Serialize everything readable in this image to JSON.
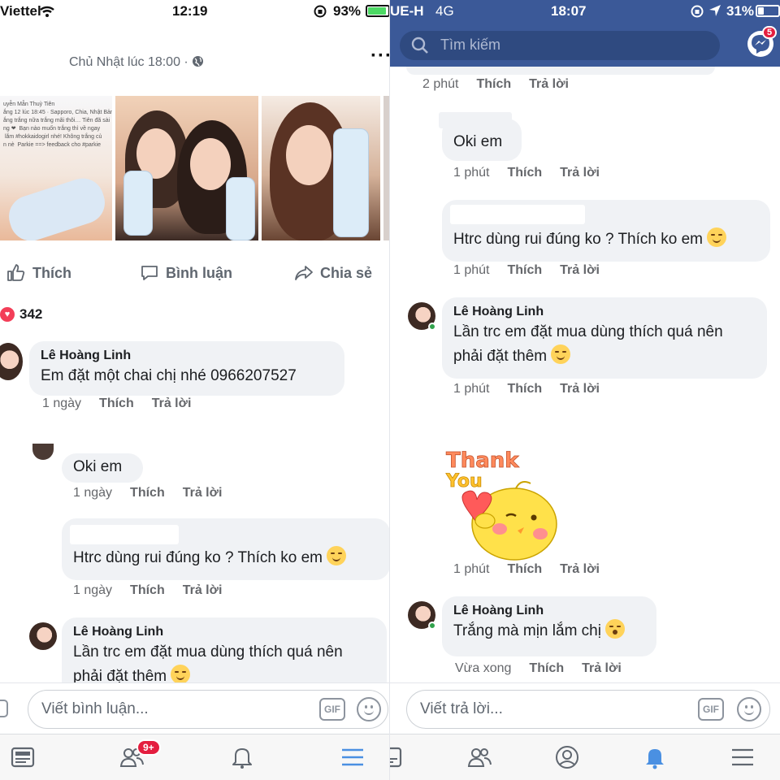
{
  "left": {
    "status": {
      "carrier": "Viettel",
      "time": "12:19",
      "battery": "93%",
      "battery_level": 0.93
    },
    "post": {
      "time": "Chủ Nhật lúc 18:00 ·",
      "photo_text": "uyễn Mẫn Thuỳ Tiên\nắng 12 lúc 18:45 · Sapporo, Chia, Nhật Bản · \nắng trắng nữa trắng mãi thôi… Tiên đã sài\nng ❤  Bạn nào muốn trắng thì về ngay\n lắm #hokkaidogirl nhé! Không trắng củ\nn nè  Parkie ==> feedback cho #parkie"
    },
    "actions": {
      "like": "Thích",
      "comment": "Bình luận",
      "share": "Chia sẻ"
    },
    "reaction_count": "342",
    "comments": [
      {
        "name": "Lê Hoàng Linh",
        "text": "Em đặt một chai chị nhé 0966207527",
        "time": "1 ngày",
        "like": "Thích",
        "reply": "Trả lời"
      },
      {
        "name": "",
        "text": "Oki em",
        "time": "1 ngày",
        "like": "Thích",
        "reply": "Trả lời"
      },
      {
        "name": "",
        "text": "Htrc dùng rui đúng ko ? Thích ko em",
        "time": "1 ngày",
        "like": "Thích",
        "reply": "Trả lời"
      },
      {
        "name": "Lê Hoàng Linh",
        "text_line1": "Lần trc em đặt mua dùng thích quá nên",
        "text_line2": "phải đặt thêm"
      }
    ],
    "input_placeholder": "Viết bình luận...",
    "gif_label": "GIF",
    "friends_badge": "9+"
  },
  "right": {
    "status": {
      "carrier": "UE-H",
      "network": "4G",
      "time": "18:07",
      "battery": "31%",
      "battery_level": 0.31
    },
    "search_placeholder": "Tìm kiếm",
    "messenger_badge": "5",
    "top_meta": {
      "time": "2 phút",
      "like": "Thích",
      "reply": "Trả lời"
    },
    "comments": [
      {
        "text": "Oki em",
        "time": "1 phút",
        "like": "Thích",
        "reply": "Trả lời"
      },
      {
        "text": "Htrc dùng rui đúng ko ? Thích ko em",
        "time": "1 phút",
        "like": "Thích",
        "reply": "Trả lời"
      },
      {
        "name": "Lê Hoàng Linh",
        "text_line1": "Lần trc em đặt mua dùng thích quá nên",
        "text_line2": "phải đặt thêm",
        "time": "1 phút",
        "like": "Thích",
        "reply": "Trả lời"
      },
      {
        "time": "1 phút",
        "like": "Thích",
        "reply": "Trả lời"
      },
      {
        "name": "Lê Hoàng Linh",
        "text": "Trắng mà mịn lắm chị",
        "time": "Vừa xong",
        "like": "Thích",
        "reply": "Trả lời"
      }
    ],
    "sticker": {
      "line1": "Thank",
      "line2": "You"
    },
    "input_placeholder": "Viết trả lời...",
    "gif_label": "GIF"
  },
  "colors": {
    "fb_blue": "#3b5998",
    "bubble": "#f0f2f5",
    "heart": "#f33e58",
    "badge": "#e41e3f",
    "bell_active": "#4a90e2"
  }
}
